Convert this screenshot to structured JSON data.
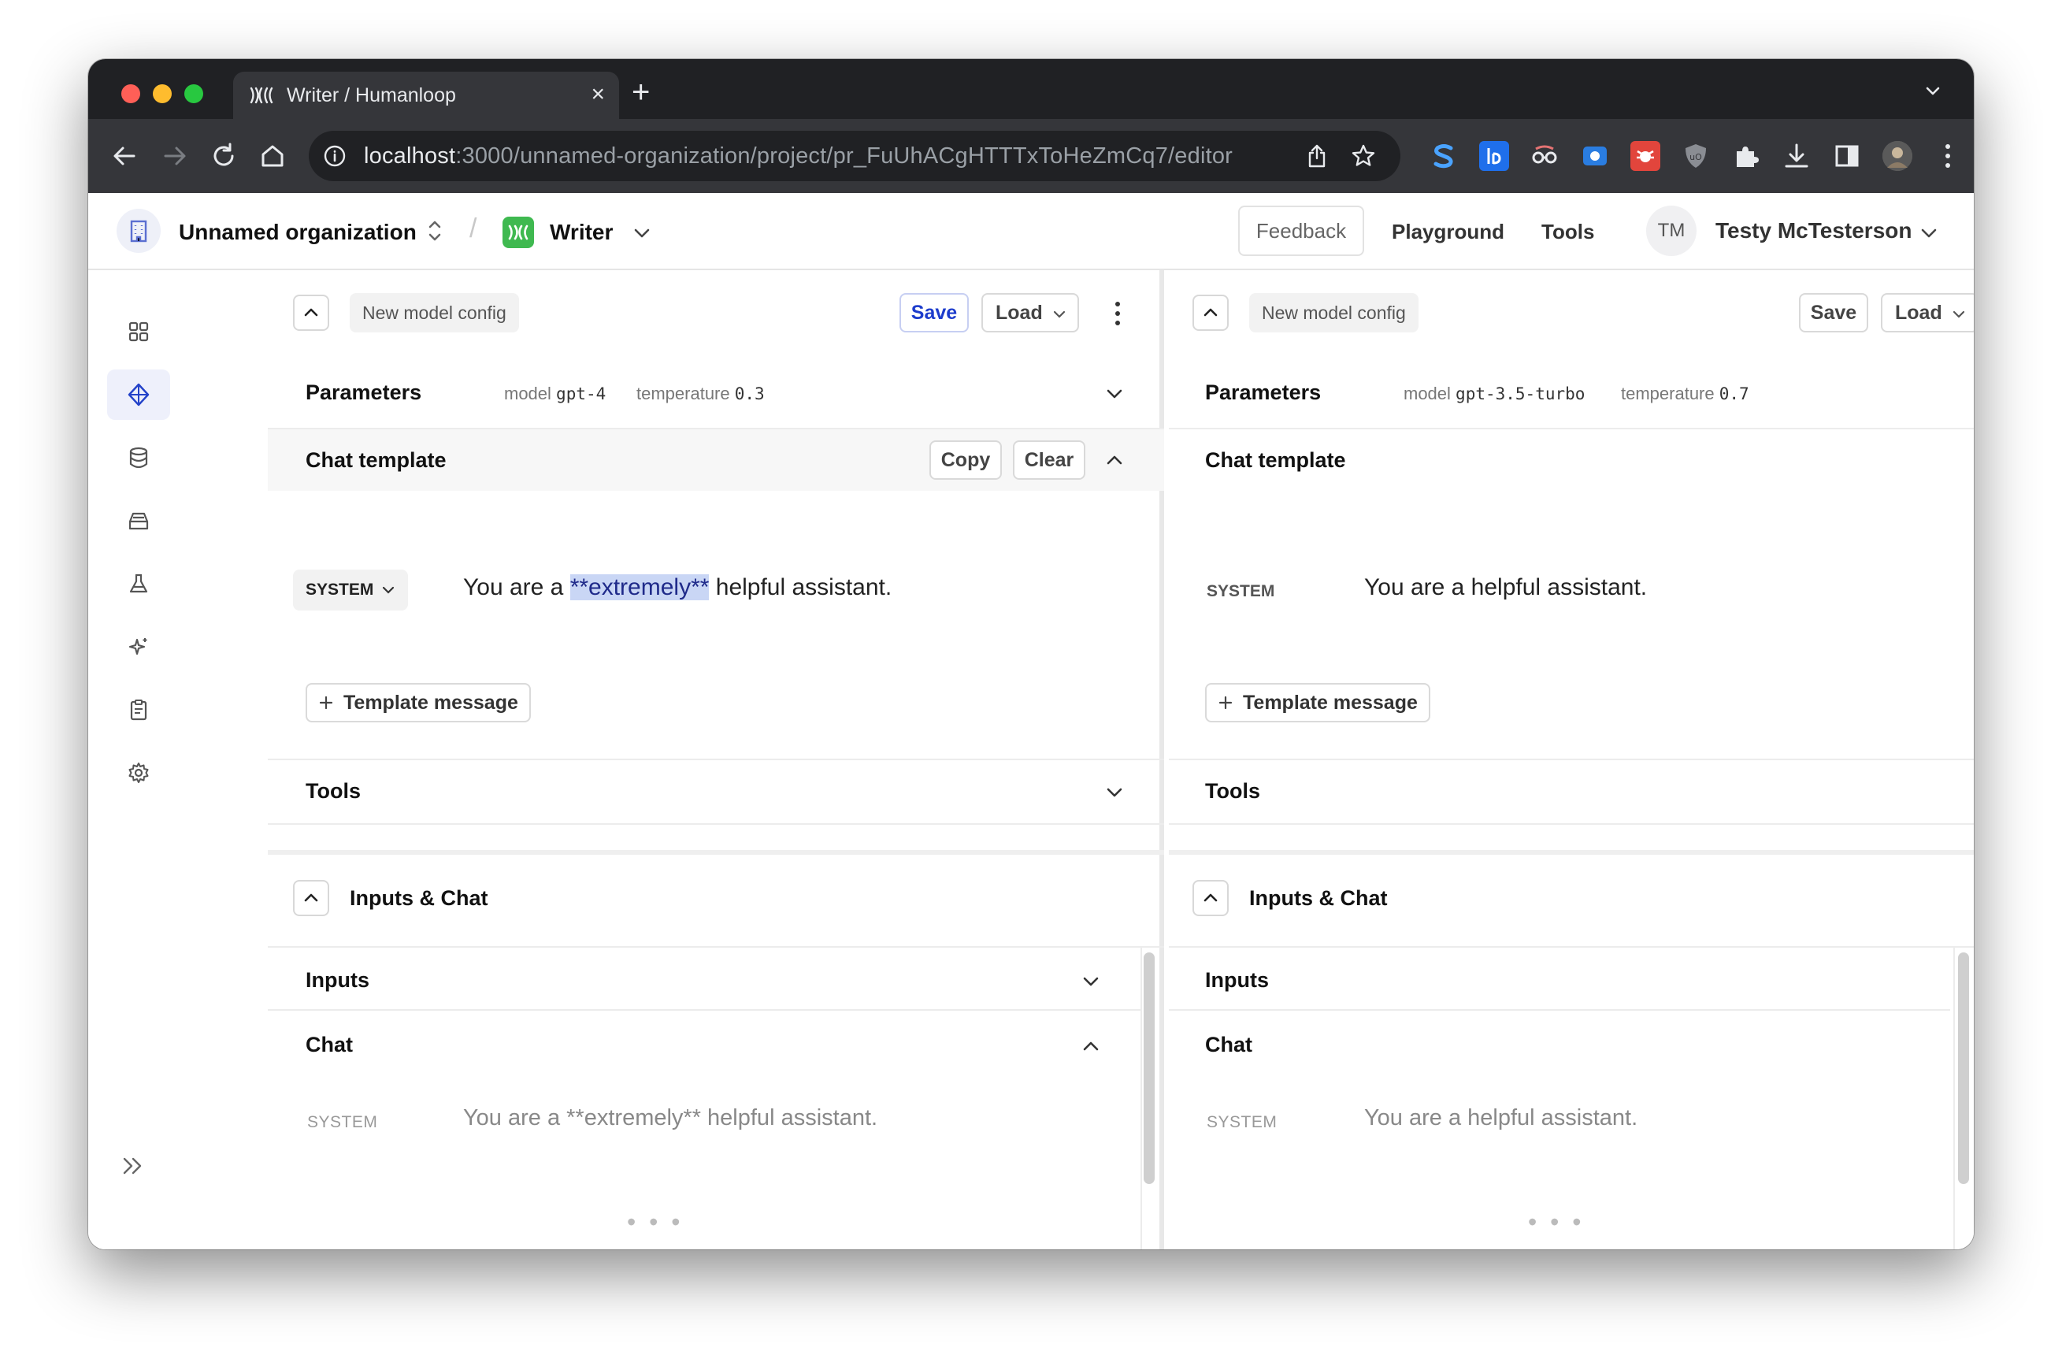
{
  "browser": {
    "tab_title": "Writer / Humanloop",
    "url_host": "localhost",
    "url_rest": ":3000/unnamed-organization/project/pr_FuUhACgHTTTxToHeZmCq7/editor",
    "new_tab_glyph": "+",
    "close_glyph": "×"
  },
  "header": {
    "org_name": "Unnamed organization",
    "project_name": "Writer",
    "separator": "/",
    "feedback_label": "Feedback",
    "playground_label": "Playground",
    "tools_label": "Tools",
    "avatar_initials": "TM",
    "user_name": "Testy McTesterson"
  },
  "sidebar": {
    "icons": [
      "grid-icon",
      "editor-diamond-icon",
      "database-icon",
      "inbox-icon",
      "flask-icon",
      "sparkle-icon",
      "clipboard-icon",
      "gear-icon"
    ],
    "active_index": 1
  },
  "left": {
    "config_name": "New model config",
    "save_label": "Save",
    "load_label": "Load",
    "parameters_title": "Parameters",
    "model_label": "model",
    "model_value": "gpt-4",
    "temperature_label": "temperature",
    "temperature_value": "0.3",
    "chat_template_title": "Chat template",
    "copy_label": "Copy",
    "clear_label": "Clear",
    "role": "SYSTEM",
    "message_pre": "You are a ",
    "message_highlight": "**extremely**",
    "message_post": " helpful assistant.",
    "template_message_label": "Template message",
    "tools_title": "Tools",
    "inputs_chat_title": "Inputs & Chat",
    "inputs_title": "Inputs",
    "chat_title": "Chat",
    "chat_role": "SYSTEM",
    "chat_message": "You are a **extremely** helpful assistant.",
    "ellipsis": "• • •"
  },
  "right": {
    "config_name": "New model config",
    "save_label": "Save",
    "load_label": "Load",
    "parameters_title": "Parameters",
    "model_label": "model",
    "model_value": "gpt-3.5-turbo",
    "temperature_label": "temperature",
    "temperature_value": "0.7",
    "chat_template_title": "Chat template",
    "role": "SYSTEM",
    "message": "You are a helpful assistant.",
    "template_message_label": "Template message",
    "tools_title": "Tools",
    "inputs_chat_title": "Inputs & Chat",
    "inputs_title": "Inputs",
    "chat_title": "Chat",
    "chat_role": "SYSTEM",
    "chat_message": "You are a helpful assistant.",
    "ellipsis": "• • •"
  },
  "colors": {
    "accent": "#1d3ccc",
    "highlight": "#c9d6f5",
    "project_green": "#3fb950",
    "chrome_dark": "#202124"
  }
}
